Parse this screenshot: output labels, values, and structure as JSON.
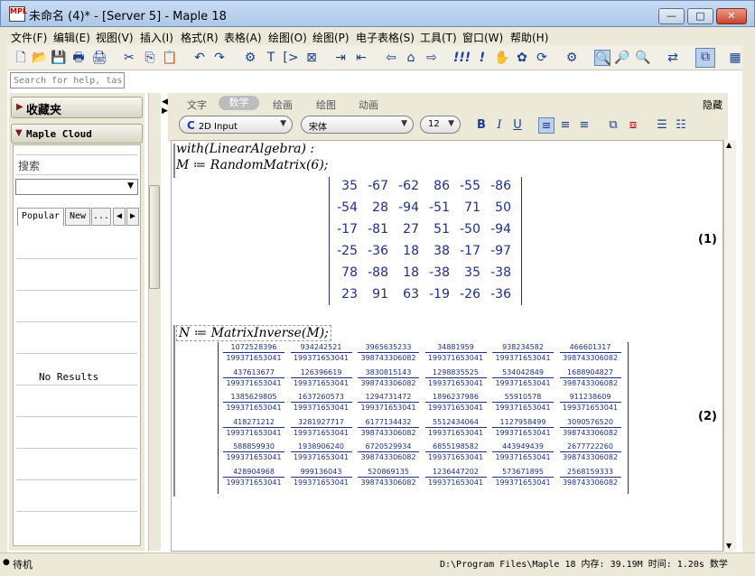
{
  "window": {
    "title": "未命名 (4)* - [Server 5] - Maple 18",
    "app_icon_text": "MPL"
  },
  "window_buttons": {
    "minimize": "—",
    "maximize": "□",
    "close": "✕"
  },
  "menu": [
    "文件(F)",
    "编辑(E)",
    "视图(V)",
    "插入(I)",
    "格式(R)",
    "表格(A)",
    "绘图(O)",
    "绘图(P)",
    "电子表格(S)",
    "工具(T)",
    "窗口(W)",
    "帮助(H)"
  ],
  "toolbar": {
    "icons": [
      "new-document-icon",
      "open-icon",
      "save-icon",
      "print-icon",
      "print-preview-icon",
      "cut-icon",
      "copy-icon",
      "paste-icon",
      "undo-icon",
      "redo-icon",
      "insert-math-icon",
      "insert-text-icon",
      "insert-prompt-icon",
      "execution-group-icon",
      "indent-icon",
      "outdent-icon",
      "back-icon",
      "home-icon",
      "forward-icon",
      "execute-all-icon",
      "execute-icon",
      "stop-icon",
      "debug-icon",
      "restart-icon",
      "settings-icon",
      "zoom-100-icon",
      "zoom-in-icon",
      "zoom-out-icon",
      "toggle-icon",
      "help-icon"
    ],
    "glyphs": [
      "🗋",
      "📂",
      "💾",
      "🖶",
      "🖨",
      "✂",
      "⎘",
      "📋",
      "↶",
      "↷",
      "⚙",
      "T",
      "[>",
      "⊠",
      "⇥",
      "⇤",
      "⇦",
      "⌂",
      "⇨",
      "!!!",
      "!",
      "✋",
      "✿",
      "⟳",
      "⚙",
      "🔍",
      "🔎",
      "🔍",
      "⇄",
      "⧉"
    ]
  },
  "search": {
    "placeholder": "Search for help, tas"
  },
  "palettes": {
    "favorites": "收藏夹",
    "cloud": "Maple Cloud",
    "cloud_search_label": "搜索",
    "tabs": [
      "Popular",
      "New",
      "...",
      "◀",
      "▶"
    ],
    "no_results": "No Results"
  },
  "context_bar": {
    "modes": [
      "文字",
      "数学",
      "绘画",
      "绘图",
      "动画"
    ],
    "active_mode": "数学",
    "hide": "隐藏",
    "input_mode": "2D Input",
    "input_icon": "C",
    "font": "宋体",
    "size": "12",
    "bold": "B",
    "italic": "I",
    "underline": "U"
  },
  "document": {
    "prompt": ">",
    "line1": "with(LinearAlgebra) :",
    "line2": "M ≔ RandomMatrix(6);",
    "line3": "N ≔ MatrixInverse(M);",
    "matrix_M": [
      [
        "35",
        "-67",
        "-62",
        "86",
        "-55",
        "-86"
      ],
      [
        "-54",
        "28",
        "-94",
        "-51",
        "71",
        "50"
      ],
      [
        "-17",
        "-81",
        "27",
        "51",
        "-50",
        "-94"
      ],
      [
        "-25",
        "-36",
        "18",
        "38",
        "-17",
        "-97"
      ],
      [
        "78",
        "-88",
        "18",
        "-38",
        "35",
        "-38"
      ],
      [
        "23",
        "91",
        "63",
        "-19",
        "-26",
        "-36"
      ]
    ],
    "eq1": "(1)",
    "eq2": "(2)",
    "matrix_N": [
      [
        [
          "1072528396",
          "199371653041"
        ],
        [
          "934242521",
          "199371653041"
        ],
        [
          "3965635233",
          "398743306082"
        ],
        [
          "34881959",
          "199371653041"
        ],
        [
          "938234582",
          "199371653041"
        ],
        [
          "466601317",
          "398743306082"
        ]
      ],
      [
        [
          "437613677",
          "199371653041"
        ],
        [
          "126396619",
          "199371653041"
        ],
        [
          "3830815143",
          "398743306082"
        ],
        [
          "1298835525",
          "199371653041"
        ],
        [
          "534042849",
          "199371653041"
        ],
        [
          "1688904827",
          "398743306082"
        ]
      ],
      [
        [
          "1385629805",
          "199371653041"
        ],
        [
          "1637260573",
          "199371653041"
        ],
        [
          "1294731472",
          "199371653041"
        ],
        [
          "1896237986",
          "199371653041"
        ],
        [
          "55910578",
          "199371653041"
        ],
        [
          "911238609",
          "199371653041"
        ]
      ],
      [
        [
          "418271212",
          "199371653041"
        ],
        [
          "3281927717",
          "199371653041"
        ],
        [
          "6177134432",
          "398743306082"
        ],
        [
          "5512434064",
          "199371653041"
        ],
        [
          "1127958499",
          "199371653041"
        ],
        [
          "3090576520",
          "398743306082"
        ]
      ],
      [
        [
          "588859930",
          "199371653041"
        ],
        [
          "1938906240",
          "199371653041"
        ],
        [
          "6720529934",
          "398743306082"
        ],
        [
          "6855198582",
          "199371653041"
        ],
        [
          "443949439",
          "199371653041"
        ],
        [
          "2677722260",
          "398743306082"
        ]
      ],
      [
        [
          "428904968",
          "199371653041"
        ],
        [
          "999136043",
          "199371653041"
        ],
        [
          "520869135",
          "398743306082"
        ],
        [
          "1236447202",
          "199371653041"
        ],
        [
          "573671895",
          "199371653041"
        ],
        [
          "2568159333",
          "398743306082"
        ]
      ]
    ]
  },
  "status": {
    "ready": "待机",
    "info": "D:\\Program Files\\Maple 18  内存: 39.19M  时间: 1.20s  数学"
  }
}
